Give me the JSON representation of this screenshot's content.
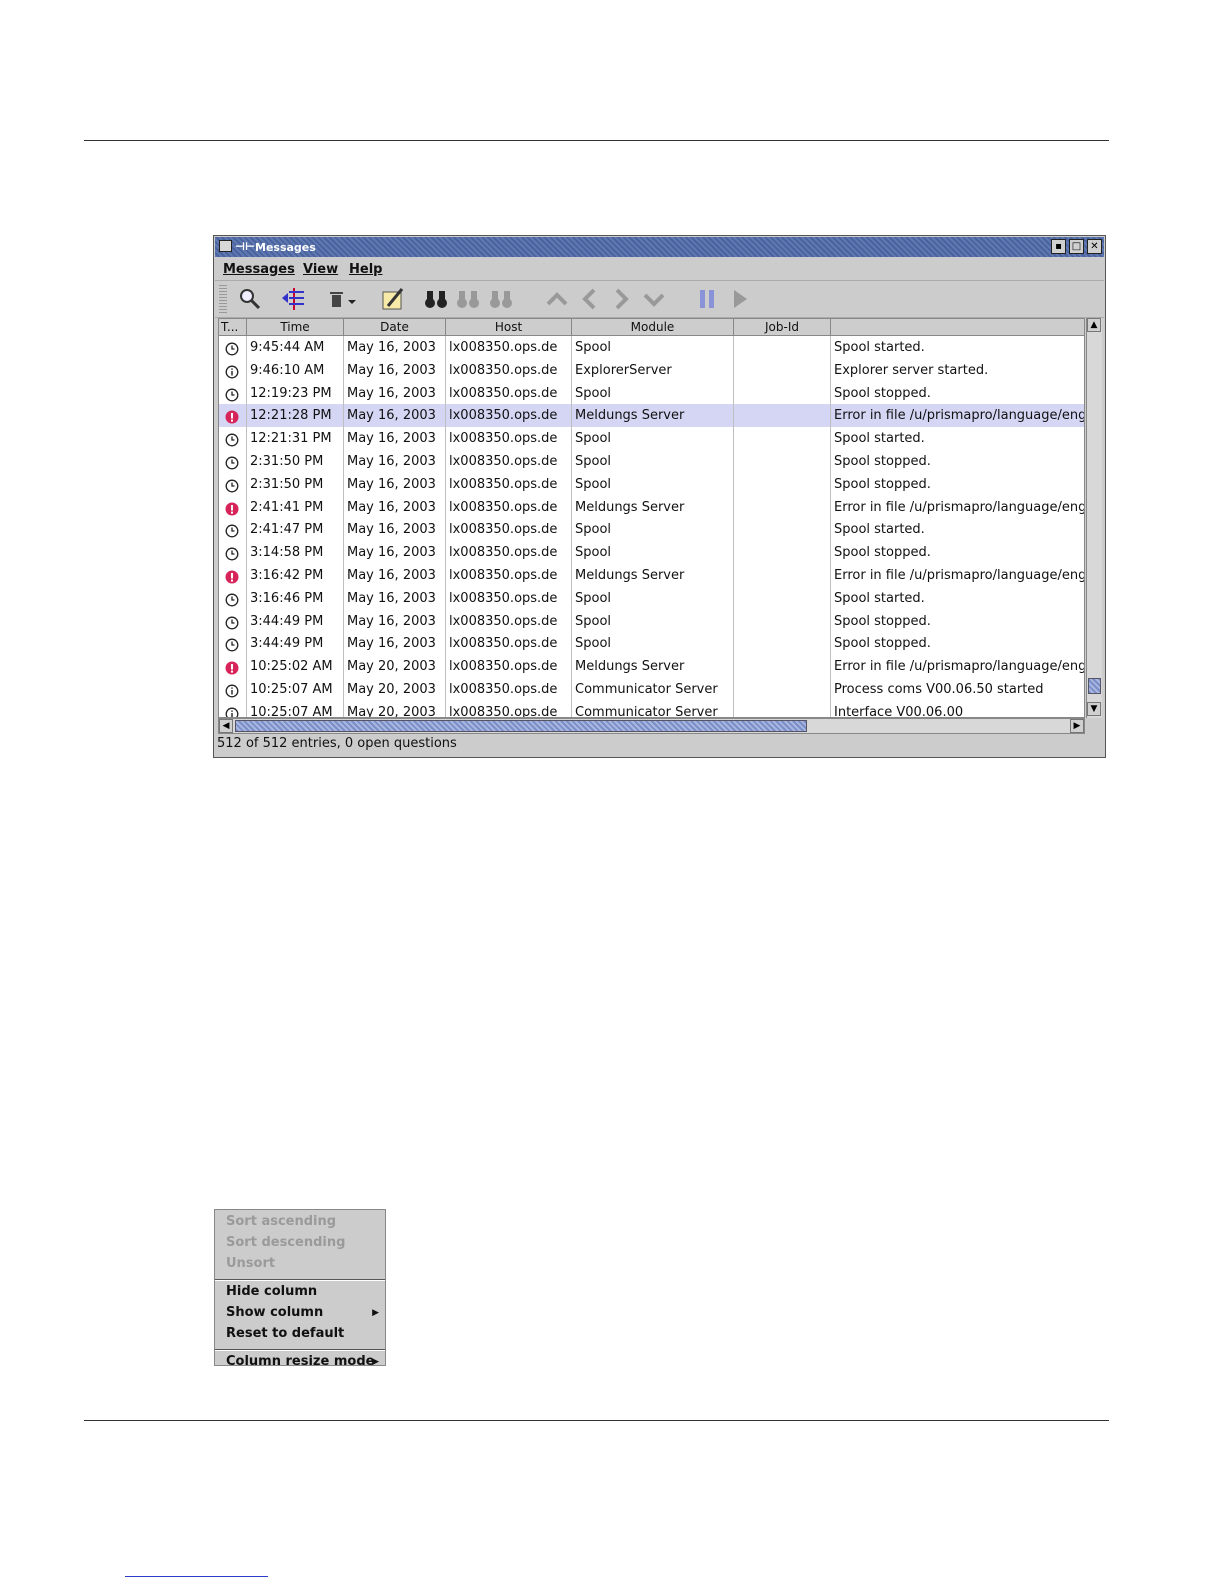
{
  "window": {
    "title": "Messages",
    "menus": [
      "Messages",
      "View",
      "Help"
    ],
    "tools": [
      "search-icon",
      "filter-icon",
      "delete-icon",
      "dropdown-icon",
      "edit-note-icon",
      "binoculars-icon",
      "binoculars-prev-icon",
      "binoculars-next-icon",
      "up-icon",
      "left-icon",
      "right-icon",
      "down-icon",
      "pause-icon",
      "play-icon"
    ]
  },
  "table": {
    "columns": [
      "T...",
      "Time",
      "Date",
      "Host",
      "Module",
      "Job-Id",
      ""
    ],
    "rows": [
      {
        "type": "clock",
        "time": "9:45:44 AM",
        "date": "May 16, 2003",
        "host": "lx008350.ops.de",
        "module": "Spool",
        "jobid": "",
        "text": "Spool started."
      },
      {
        "type": "info",
        "time": "9:46:10 AM",
        "date": "May 16, 2003",
        "host": "lx008350.ops.de",
        "module": "ExplorerServer",
        "jobid": "",
        "text": "Explorer server started."
      },
      {
        "type": "clock",
        "time": "12:19:23 PM",
        "date": "May 16, 2003",
        "host": "lx008350.ops.de",
        "module": "Spool",
        "jobid": "",
        "text": "Spool stopped."
      },
      {
        "type": "error",
        "time": "12:21:28 PM",
        "date": "May 16, 2003",
        "host": "lx008350.ops.de",
        "module": "Meldungs Server",
        "jobid": "",
        "text": "Error in file /u/prismapro/language/engl",
        "selected": true
      },
      {
        "type": "clock",
        "time": "12:21:31 PM",
        "date": "May 16, 2003",
        "host": "lx008350.ops.de",
        "module": "Spool",
        "jobid": "",
        "text": "Spool started."
      },
      {
        "type": "clock",
        "time": "2:31:50 PM",
        "date": "May 16, 2003",
        "host": "lx008350.ops.de",
        "module": "Spool",
        "jobid": "",
        "text": "Spool stopped."
      },
      {
        "type": "clock",
        "time": "2:31:50 PM",
        "date": "May 16, 2003",
        "host": "lx008350.ops.de",
        "module": "Spool",
        "jobid": "",
        "text": "Spool stopped."
      },
      {
        "type": "error",
        "time": "2:41:41 PM",
        "date": "May 16, 2003",
        "host": "lx008350.ops.de",
        "module": "Meldungs Server",
        "jobid": "",
        "text": "Error in file /u/prismapro/language/engl"
      },
      {
        "type": "clock",
        "time": "2:41:47 PM",
        "date": "May 16, 2003",
        "host": "lx008350.ops.de",
        "module": "Spool",
        "jobid": "",
        "text": "Spool started."
      },
      {
        "type": "clock",
        "time": "3:14:58 PM",
        "date": "May 16, 2003",
        "host": "lx008350.ops.de",
        "module": "Spool",
        "jobid": "",
        "text": "Spool stopped."
      },
      {
        "type": "error",
        "time": "3:16:42 PM",
        "date": "May 16, 2003",
        "host": "lx008350.ops.de",
        "module": "Meldungs Server",
        "jobid": "",
        "text": "Error in file /u/prismapro/language/engl"
      },
      {
        "type": "clock",
        "time": "3:16:46 PM",
        "date": "May 16, 2003",
        "host": "lx008350.ops.de",
        "module": "Spool",
        "jobid": "",
        "text": "Spool started."
      },
      {
        "type": "clock",
        "time": "3:44:49 PM",
        "date": "May 16, 2003",
        "host": "lx008350.ops.de",
        "module": "Spool",
        "jobid": "",
        "text": "Spool stopped."
      },
      {
        "type": "clock",
        "time": "3:44:49 PM",
        "date": "May 16, 2003",
        "host": "lx008350.ops.de",
        "module": "Spool",
        "jobid": "",
        "text": "Spool stopped."
      },
      {
        "type": "error",
        "time": "10:25:02 AM",
        "date": "May 20, 2003",
        "host": "lx008350.ops.de",
        "module": "Meldungs Server",
        "jobid": "",
        "text": "Error in file /u/prismapro/language/engl"
      },
      {
        "type": "info",
        "time": "10:25:07 AM",
        "date": "May 20, 2003",
        "host": "lx008350.ops.de",
        "module": "Communicator Server",
        "jobid": "",
        "text": "Process coms V00.06.50 started"
      },
      {
        "type": "info",
        "time": "10:25:07 AM",
        "date": "May 20, 2003",
        "host": "lx008350.ops.de",
        "module": "Communicator Server",
        "jobid": "",
        "text": "Interface V00.06.00"
      }
    ]
  },
  "status": "512 of 512 entries,  0 open questions",
  "context_menu": {
    "groups": [
      [
        {
          "label": "Sort ascending",
          "enabled": false,
          "submenu": false
        },
        {
          "label": "Sort descending",
          "enabled": false,
          "submenu": false
        },
        {
          "label": "Unsort",
          "enabled": false,
          "submenu": false
        }
      ],
      [
        {
          "label": "Hide column",
          "enabled": true,
          "submenu": false
        },
        {
          "label": "Show column",
          "enabled": true,
          "submenu": true
        },
        {
          "label": "Reset to default",
          "enabled": true,
          "submenu": false
        }
      ],
      [
        {
          "label": "Column resize mode",
          "enabled": true,
          "submenu": true
        }
      ]
    ]
  },
  "colors": {
    "selected_row": "#d4d6f4",
    "error_icon": "#d6245a",
    "title_bar": "#5f79b0"
  }
}
